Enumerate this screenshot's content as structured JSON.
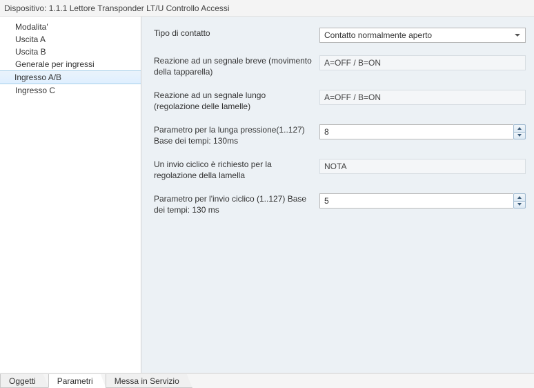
{
  "title": "Dispositivo: 1.1.1 Lettore Transponder LT/U Controllo Accessi",
  "sidebar": {
    "items": [
      {
        "label": "Modalita'"
      },
      {
        "label": "Uscita A"
      },
      {
        "label": "Uscita B"
      },
      {
        "label": "Generale per ingressi"
      },
      {
        "label": "Ingresso A/B"
      },
      {
        "label": "Ingresso C"
      }
    ],
    "selectedIndex": 4
  },
  "params": {
    "tipoContatto": {
      "label": "Tipo di contatto",
      "value": "Contatto normalmente aperto"
    },
    "reazioneBreve": {
      "label": "Reazione ad un segnale breve (movimento della tapparella)",
      "value": "A=OFF /  B=ON"
    },
    "reazioneLungo": {
      "label": "Reazione ad un segnale lungo (regolazione delle lamelle)",
      "value": "A=OFF /  B=ON"
    },
    "lungaPressione": {
      "label": "Parametro per la lunga pressione(1..127) Base dei tempi: 130ms",
      "value": "8"
    },
    "invioCiclicoRichiesto": {
      "label": "Un invio ciclico è richiesto per la regolazione della lamella",
      "value": "NOTA"
    },
    "invioCiclico": {
      "label": "Parametro per l'invio ciclico (1..127) Base dei tempi: 130 ms",
      "value": "5"
    }
  },
  "tabs": [
    {
      "label": "Oggetti"
    },
    {
      "label": "Parametri"
    },
    {
      "label": "Messa in Servizio"
    }
  ],
  "activeTabIndex": 1
}
